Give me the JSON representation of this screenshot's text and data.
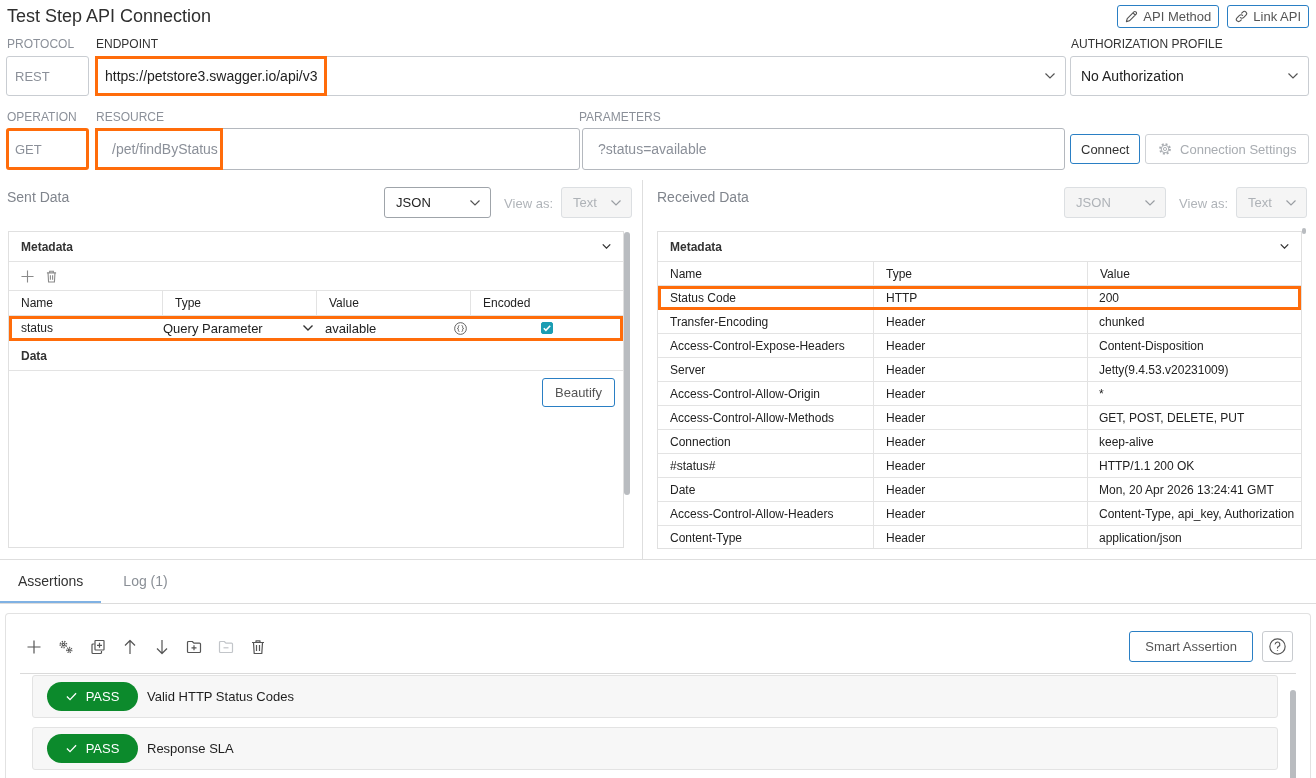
{
  "header": {
    "title": "Test Step API Connection",
    "buttons": [
      "API Method",
      "Link API"
    ]
  },
  "connection": {
    "protocol": {
      "label": "PROTOCOL",
      "value": "REST",
      "disabled": true,
      "highlighted": false
    },
    "endpoint": {
      "label": "ENDPOINT",
      "value": "https://petstore3.swagger.io/api/v3",
      "disabled": false,
      "highlighted": true
    },
    "authorization": {
      "label": "AUTHORIZATION PROFILE",
      "value": "No Authorization",
      "disabled": false
    },
    "operation": {
      "label": "OPERATION",
      "value": "GET",
      "disabled": true,
      "highlighted": true
    },
    "resource": {
      "label": "RESOURCE",
      "value": "/pet/findByStatus",
      "disabled": true,
      "highlighted": true
    },
    "parameters": {
      "label": "PARAMETERS",
      "value": "?status=available",
      "disabled": true,
      "highlighted": false
    },
    "connect_button": {
      "label": "Connect",
      "disabled": false
    },
    "settings_button": {
      "label": "Connection Settings",
      "disabled": true
    }
  },
  "sent_data": {
    "title": "Sent Data",
    "format_select": {
      "value": "JSON",
      "disabled": false
    },
    "view_as": {
      "label": "View as:",
      "value": "Text",
      "disabled": true
    },
    "metadata": {
      "title": "Metadata",
      "expanded": true,
      "columns": [
        "Name",
        "Type",
        "Value",
        "Encoded"
      ],
      "rows": [
        {
          "name": "status",
          "type": "Query Parameter",
          "value": "available",
          "encoded": true,
          "highlighted": true
        }
      ]
    },
    "data": {
      "title": "Data",
      "beautify_button": "Beautify"
    }
  },
  "received_data": {
    "title": "Received Data",
    "format_select": {
      "value": "JSON",
      "disabled": true
    },
    "view_as": {
      "label": "View as:",
      "value": "Text",
      "disabled": true
    },
    "metadata": {
      "title": "Metadata",
      "expanded": true,
      "columns": [
        "Name",
        "Type",
        "Value"
      ],
      "rows": [
        {
          "name": "Status Code",
          "type": "HTTP",
          "value": "200",
          "highlighted": true
        },
        {
          "name": "Transfer-Encoding",
          "type": "Header",
          "value": "chunked",
          "highlighted": false
        },
        {
          "name": "Access-Control-Expose-Headers",
          "type": "Header",
          "value": "Content-Disposition",
          "highlighted": false
        },
        {
          "name": "Server",
          "type": "Header",
          "value": "Jetty(9.4.53.v20231009)",
          "highlighted": false
        },
        {
          "name": "Access-Control-Allow-Origin",
          "type": "Header",
          "value": "*",
          "highlighted": false
        },
        {
          "name": "Access-Control-Allow-Methods",
          "type": "Header",
          "value": "GET, POST, DELETE, PUT",
          "highlighted": false
        },
        {
          "name": "Connection",
          "type": "Header",
          "value": "keep-alive",
          "highlighted": false
        },
        {
          "name": "#status#",
          "type": "Header",
          "value": "HTTP/1.1 200 OK",
          "highlighted": false
        },
        {
          "name": "Date",
          "type": "Header",
          "value": "Mon, 20 Apr 2026 13:24:41 GMT",
          "highlighted": false
        },
        {
          "name": "Access-Control-Allow-Headers",
          "type": "Header",
          "value": "Content-Type, api_key, Authorization",
          "highlighted": false
        },
        {
          "name": "Content-Type",
          "type": "Header",
          "value": "application/json",
          "highlighted": false
        }
      ]
    }
  },
  "bottom_tabs": [
    {
      "label": "Assertions",
      "selected": true
    },
    {
      "label": "Log (1)",
      "selected": false
    }
  ],
  "assertions": {
    "toolbar": [
      {
        "disabled": false
      },
      {
        "disabled": false
      },
      {
        "disabled": false
      },
      {
        "disabled": false
      },
      {
        "disabled": false
      },
      {
        "disabled": false
      },
      {
        "disabled": true
      },
      {
        "disabled": false
      }
    ],
    "smart_assertion_button": "Smart Assertion",
    "items": [
      {
        "status": "PASS",
        "passed": true,
        "name": "Valid HTTP Status Codes"
      },
      {
        "status": "PASS",
        "passed": true,
        "name": "Response SLA"
      }
    ]
  }
}
